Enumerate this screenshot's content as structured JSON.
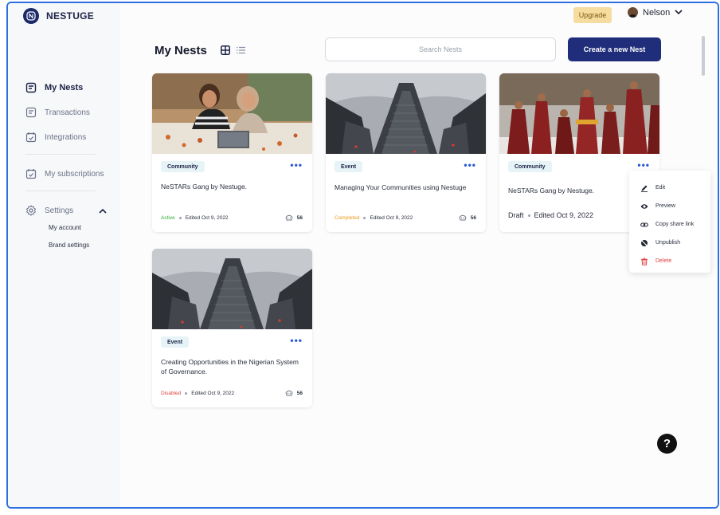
{
  "brand": {
    "name": "NESTUGE"
  },
  "topbar": {
    "upgrade_label": "Upgrade",
    "user_name": "Nelson"
  },
  "sidebar": {
    "items": [
      {
        "label": "My Nests",
        "icon": "nests-icon",
        "active": true
      },
      {
        "label": "Transactions",
        "icon": "transactions-icon"
      },
      {
        "label": "Integrations",
        "icon": "integrations-icon"
      },
      {
        "label": "My subscriptions",
        "icon": "subscriptions-icon"
      },
      {
        "label": "Settings",
        "icon": "gear-icon"
      }
    ],
    "settings_sub": [
      "My account",
      "Brand settings"
    ]
  },
  "main": {
    "title": "My Nests",
    "search_placeholder": "Search Nests",
    "create_label": "Create a new Nest"
  },
  "cards": [
    {
      "tag": "Community",
      "title": "NeSTARs Gang by Nestuge.",
      "status": "Active",
      "status_color": "#2fae3c",
      "edited": "Edited Oct 9, 2022",
      "views": "56",
      "image": "friends-laptop"
    },
    {
      "tag": "Event",
      "title": "Managing Your Communities using Nestuge",
      "status": "Completed",
      "status_color": "#e89a1b",
      "edited": "Edited Oct 9, 2022",
      "views": "56",
      "image": "skyscrapers"
    },
    {
      "tag": "Community",
      "title": "NeSTARs Gang by Nestuge.",
      "status": "Draft",
      "status_color": "#2a2f3e",
      "edited": "Edited Oct 9, 2022",
      "views": "",
      "image": "monks"
    },
    {
      "tag": "Event",
      "title": "Creating Opportunities in the Nigerian System of Governance.",
      "status": "Disabled",
      "status_color": "#e04040",
      "edited": "Edited Oct 9, 2022",
      "views": "56",
      "image": "skyscrapers"
    }
  ],
  "menu": {
    "items": [
      {
        "label": "Edit",
        "icon": "pencil-icon"
      },
      {
        "label": "Preview",
        "icon": "eye-icon"
      },
      {
        "label": "Copy share link",
        "icon": "link-icon"
      },
      {
        "label": "Unpublish",
        "icon": "unpublish-icon"
      },
      {
        "label": "Delete",
        "icon": "trash-icon"
      }
    ]
  },
  "help": {
    "label": "?"
  }
}
